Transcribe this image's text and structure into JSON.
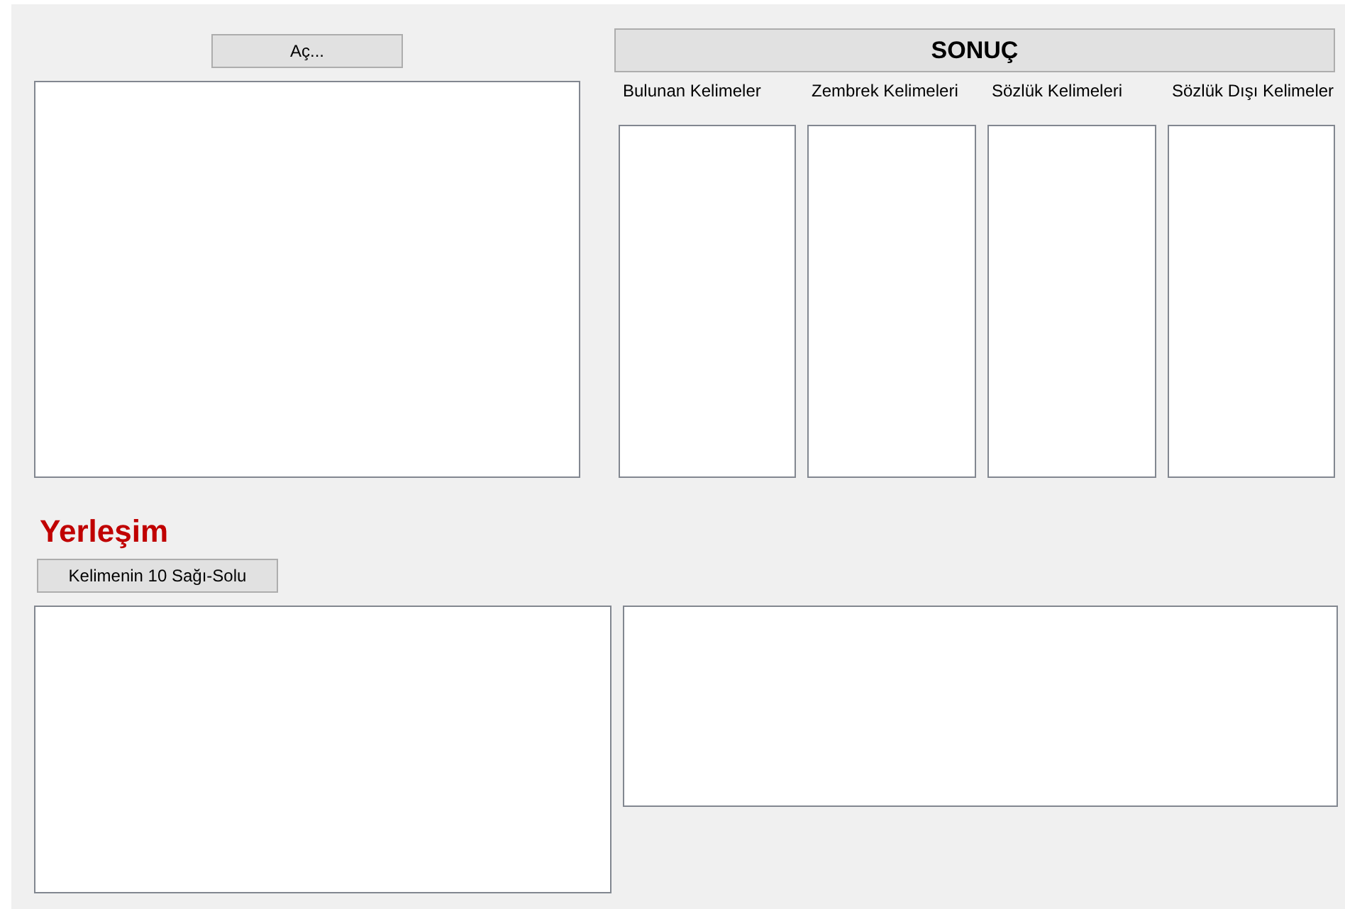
{
  "open_button": {
    "label": "Aç..."
  },
  "result_button": {
    "label": "SONUÇ"
  },
  "result_columns": [
    {
      "label": "Bulunan Kelimeler"
    },
    {
      "label": "Zembrek Kelimeleri"
    },
    {
      "label": "Sözlük Kelimeleri"
    },
    {
      "label": "Sözlük Dışı Kelimeler"
    }
  ],
  "placement_title": "Yerleşim",
  "context_button": {
    "label": "Kelimenin 10 Sağı-Solu"
  }
}
